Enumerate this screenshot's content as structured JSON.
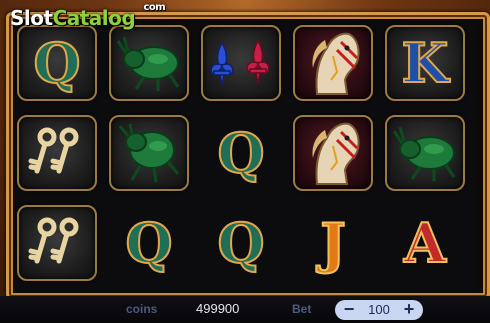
{
  "logo": {
    "part1": "Slot",
    "part2": "Catalog",
    "suffix": "com"
  },
  "reels": [
    [
      "letter-q",
      "scarab",
      "fleur-de-lis",
      "horse",
      "letter-k"
    ],
    [
      "keys",
      "scarab",
      "letter-q",
      "horse",
      "scarab"
    ],
    [
      "keys",
      "letter-q",
      "letter-q",
      "letter-j",
      "letter-a"
    ]
  ],
  "letters": {
    "q": "Q",
    "k": "K",
    "j": "J",
    "a": "A"
  },
  "footer": {
    "coins_label": "coins",
    "coins_value": "499900",
    "bet_label": "Bet",
    "bet_value": "100",
    "bet_minus": "−",
    "bet_plus": "+"
  },
  "colors": {
    "frame_gold": "#d49a4a",
    "logo_green": "#8fd13a",
    "bet_box": "#c8d6f2"
  }
}
